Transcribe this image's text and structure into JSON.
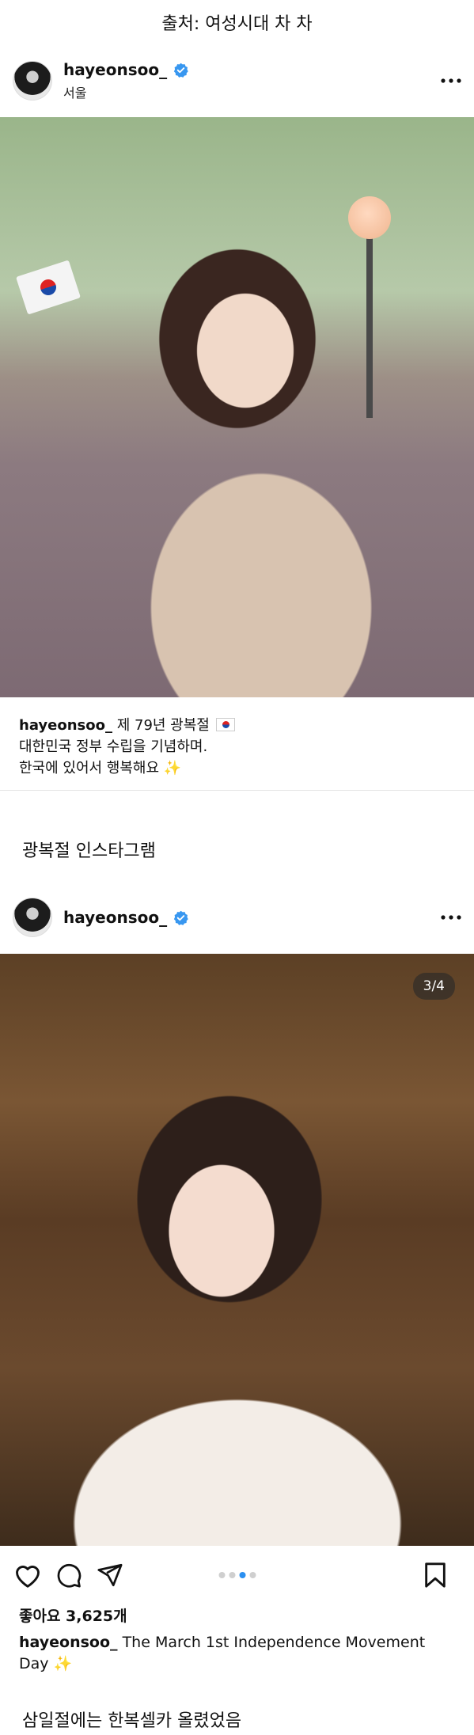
{
  "source_label": "출처: 여성시대 차 차",
  "post1": {
    "username": "hayeonsoo_",
    "location": "서울",
    "caption_username": "hayeonsoo_",
    "caption_line1": "제 79년 광복절",
    "caption_line2": "대한민국 정부 수립을 기념하며.",
    "caption_line3": "한국에 있어서 행복해요",
    "sparkle": "✨"
  },
  "article_text_1": "광복절 인스타그램",
  "post2": {
    "username": "hayeonsoo_",
    "image_counter": "3/4",
    "likes": "좋아요 3,625개",
    "caption_username": "hayeonsoo_",
    "caption_text": "The March 1st Independence Movement Day",
    "sparkle": "✨",
    "carousel_total": 4,
    "carousel_active_index": 2
  },
  "article_text_2": "삼일절에는 한복셀카 올렸었음",
  "colors": {
    "verified_blue": "#3897f0",
    "carousel_active": "#2b8ff0",
    "text": "#111111"
  },
  "icons": [
    "verified-icon",
    "more-options-icon",
    "heart-icon",
    "comment-icon",
    "share-icon",
    "bookmark-icon"
  ]
}
